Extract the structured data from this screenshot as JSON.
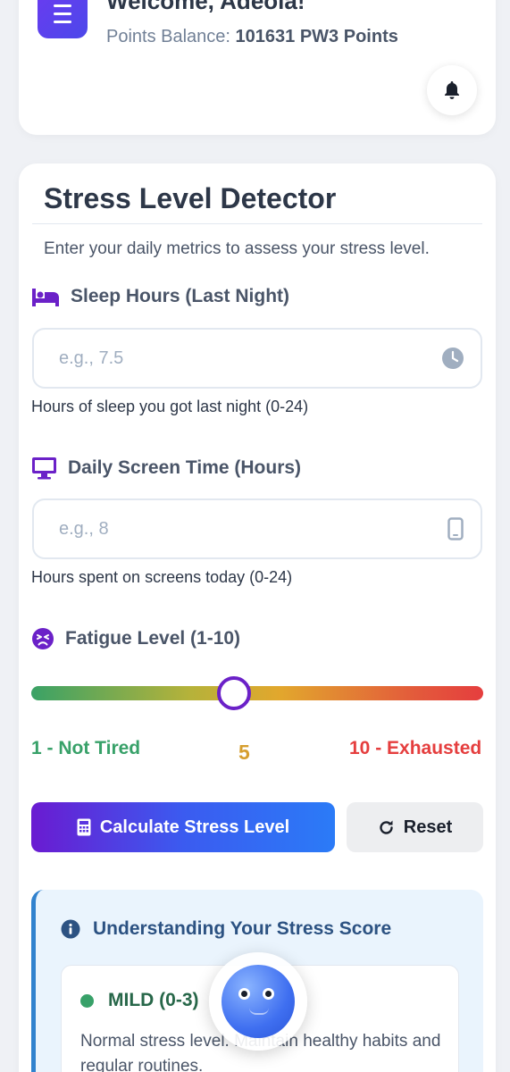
{
  "header": {
    "welcome": "Welcome, Adeola!",
    "points_label": "Points Balance:",
    "points_value": "101631 PW3 Points"
  },
  "detector": {
    "title": "Stress Level Detector",
    "subtitle": "Enter your daily metrics to assess your stress level.",
    "sleep": {
      "label": "Sleep Hours (Last Night)",
      "placeholder": "e.g., 7.5",
      "value": "",
      "help": "Hours of sleep you got last night (0-24)"
    },
    "screen": {
      "label": "Daily Screen Time (Hours)",
      "placeholder": "e.g., 8",
      "value": "",
      "help": "Hours spent on screens today (0-24)"
    },
    "fatigue": {
      "label": "Fatigue Level (1-10)",
      "min_label": "1 - Not Tired",
      "max_label": "10 - Exhausted",
      "value": "5",
      "min": 1,
      "max": 10
    },
    "calculate_label": "Calculate Stress Level",
    "reset_label": "Reset"
  },
  "info": {
    "title": "Understanding Your Stress Score",
    "levels": [
      {
        "name": "MILD (0-3)",
        "description": "Normal stress level. Maintain healthy habits and regular routines.",
        "color": "#38a169"
      }
    ]
  },
  "colors": {
    "accent": "#6b21c8",
    "info": "#2c5282",
    "mild": "#38a169",
    "moderate": "#d69e2e",
    "severe": "#e53e3e"
  }
}
